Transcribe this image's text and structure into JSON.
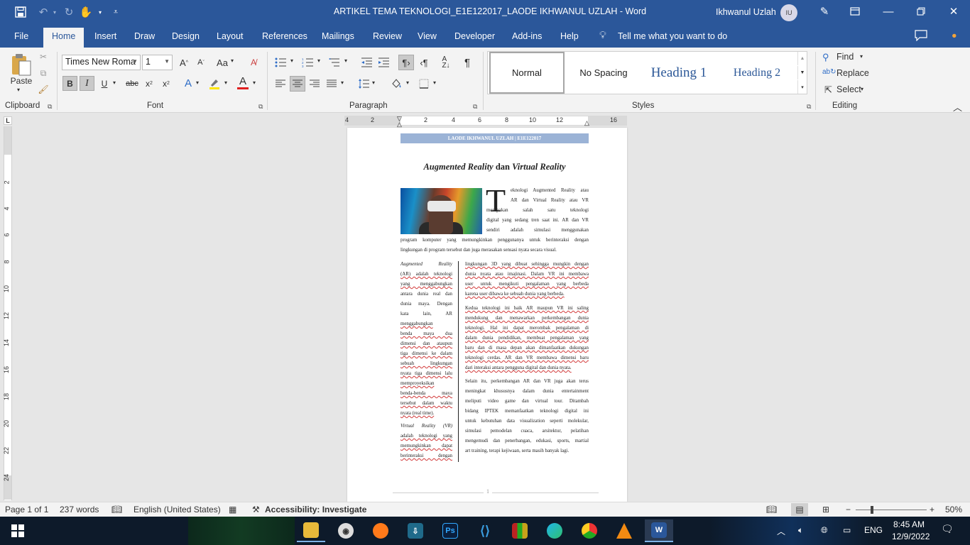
{
  "title_bar": {
    "document_title": "ARTIKEL TEMA TEKNOLOGI_E1E122017_LAODE IKHWANUL UZLAH  -  Word",
    "user_name": "Ikhwanul Uzlah",
    "user_initials": "IU",
    "icons": [
      "save-icon",
      "undo-icon",
      "redo-icon",
      "touch-mode-icon",
      "customize-qat-icon",
      "pen-icon",
      "ribbon-display-icon",
      "minimize-icon",
      "restore-icon",
      "close-icon"
    ]
  },
  "ribbon_tabs": {
    "items": [
      "File",
      "Home",
      "Insert",
      "Draw",
      "Design",
      "Layout",
      "References",
      "Mailings",
      "Review",
      "View",
      "Developer",
      "Add-ins",
      "Help"
    ],
    "active": "Home",
    "tell_me": "Tell me what you want to do"
  },
  "ribbon": {
    "clipboard": {
      "paste_label": "Paste",
      "group_label": "Clipboard"
    },
    "font": {
      "font_name": "Times New Roma",
      "font_size": "1",
      "group_label": "Font"
    },
    "paragraph": {
      "group_label": "Paragraph"
    },
    "styles": {
      "items": [
        "Normal",
        "No Spacing",
        "Heading 1",
        "Heading 2"
      ],
      "selected": "Normal",
      "group_label": "Styles"
    },
    "editing": {
      "find": "Find",
      "replace": "Replace",
      "select": "Select",
      "group_label": "Editing"
    }
  },
  "ruler": {
    "horizontal": [
      "4",
      "2",
      "2",
      "4",
      "6",
      "8",
      "10",
      "12",
      "16"
    ],
    "vertical": [
      "2",
      "4",
      "6",
      "8",
      "10",
      "12",
      "14",
      "16",
      "18",
      "20",
      "22",
      "24"
    ]
  },
  "document": {
    "header": "LAODE IKHWANUL UZLAH | E1E122017",
    "title_part1": "Augmented Reality",
    "title_part2": " dan ",
    "title_part3": "Virtual Reality",
    "dropcap": "T",
    "intro_lines": [
      "eknologi Augmented Reality atau",
      "AR dan Virtual Reality atau VR",
      "merupakan salah satu teknologi",
      "digital yang sedang tren saat ini. AR dan VR",
      "sendiri adalah simulasi menggunakan",
      "program komputer yang memungkinkan penggunanya untuk berinteraksi dengan",
      "lingkungan di program tersebut dan juga merasakan sensasi nyata secara visual."
    ],
    "left_col": [
      "Augmented Reality",
      "(AR) adalah teknologi",
      "yang menggabungkan",
      "antara dunia real dan",
      "dunia maya. Dengan",
      "kata lain, AR",
      "menggabungkan",
      "benda maya dua",
      "dimensi dan ataupun",
      "tiga dimensi ke dalam",
      "sebuah lingkungan",
      "nyata tiga dimensi lalu",
      "memproyeksikan",
      "benda-benda maya",
      "tersebut dalam waktu",
      "nyata (real time).",
      "Virtual Reality (VR)",
      "adalah teknologi yang",
      "memungkinkan dapat",
      "berinteraksi dengan"
    ],
    "right_col_p1": [
      "lingkungan 3D yang dibuat sehingga mungkin dengan",
      "dunia nyata atau imajinasi. Dalam VR ini membawa",
      "user untuk mengikuti pengalaman yang berbeda",
      "karena user dibawa ke sebuah dunia yang berbeda."
    ],
    "right_col_p2": [
      "Kedua teknologi ini baik AR maupun VR ini saling",
      "mendukung dan menawarkan perkembangan dunia",
      "teknologi. Hal ini dapat merombak pengalaman di",
      "dalam dunia pendidikan, membuat pengalaman yang",
      "baru dan di masa depan akan dimanfaatkan dukungan",
      "teknologi cerdas. AR dan VR membawa dimensi baru",
      "dari interaksi antara pengguna digital dan dunia nyata."
    ],
    "right_col_p3": [
      "Selain itu, perkembangan AR dan VR juga akan terus",
      "meningkat khususnya dalam dunia entertainment",
      "meliputi video game dan virtual tour. Ditambah",
      "bidang IPTEK memanfaatkan teknologi digital ini",
      "untuk kebutuhan data visualization seperti molekular,",
      "simulasi pemodelan cuaca, arsitektur, pelatihan",
      "mengemudi dan penerbangan, edukasi, sports, martial",
      "art training, terapi kejiwaan, serta masih banyak lagi."
    ],
    "page_number": "1"
  },
  "status_bar": {
    "page": "Page 1 of 1",
    "words": "237 words",
    "language": "English (United States)",
    "accessibility": "Accessibility: Investigate",
    "zoom": "50%"
  },
  "taskbar": {
    "apps": [
      "start-button",
      "file-explorer",
      "media-player",
      "firefox",
      "app-shortcut",
      "photoshop",
      "vscode",
      "winrar",
      "edge",
      "chrome",
      "vlc",
      "word"
    ],
    "language": "ENG",
    "time": "8:45 AM",
    "date": "12/9/2022"
  },
  "colors": {
    "word_blue": "#2b579a",
    "taskbar": "#0d1a2a",
    "header_band": "#9bb3d6"
  }
}
